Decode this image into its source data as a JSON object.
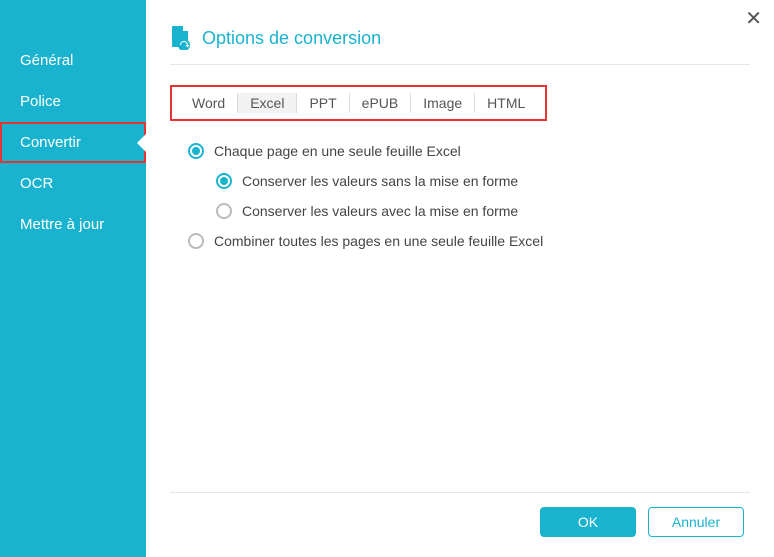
{
  "header": {
    "title": "Options de conversion"
  },
  "sidebar": {
    "items": [
      {
        "label": "Général"
      },
      {
        "label": "Police"
      },
      {
        "label": "Convertir",
        "selected": true
      },
      {
        "label": "OCR"
      },
      {
        "label": "Mettre à jour"
      }
    ]
  },
  "tabs": [
    {
      "label": "Word"
    },
    {
      "label": "Excel",
      "active": true
    },
    {
      "label": "PPT"
    },
    {
      "label": "ePUB"
    },
    {
      "label": "Image"
    },
    {
      "label": "HTML"
    }
  ],
  "options": {
    "main": [
      {
        "label": "Chaque page en une seule feuille Excel",
        "checked": true
      },
      {
        "label": "Combiner toutes les pages en une seule feuille Excel",
        "checked": false
      }
    ],
    "sub": [
      {
        "label": "Conserver les valeurs sans la mise en forme",
        "checked": true
      },
      {
        "label": "Conserver les valeurs avec la mise en forme",
        "checked": false
      }
    ]
  },
  "footer": {
    "ok": "OK",
    "cancel": "Annuler"
  },
  "close": "✕"
}
